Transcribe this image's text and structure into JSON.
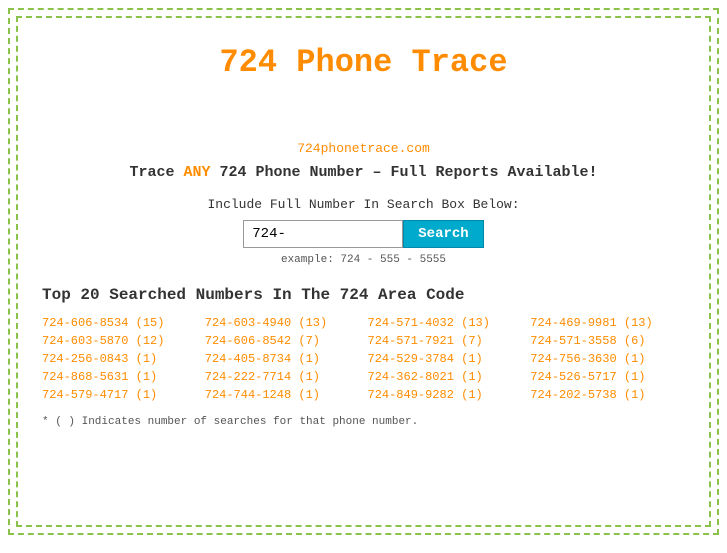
{
  "title": "724 Phone Trace",
  "siteUrl": "724phonetrace.com",
  "tagline": {
    "prefix": "Trace ",
    "highlight": "ANY",
    "suffix": " 724 Phone Number – Full Reports Available!"
  },
  "search": {
    "label": "Include Full Number In Search Box Below:",
    "inputValue": "724-",
    "placeholder": "724-",
    "buttonLabel": "Search",
    "example": "example: 724 - 555 - 5555"
  },
  "topSection": {
    "title": "Top 20 Searched Numbers In The 724 Area Code"
  },
  "phoneNumbers": [
    {
      "number": "724-606-8534",
      "count": "(15)"
    },
    {
      "number": "724-603-4940",
      "count": "(13)"
    },
    {
      "number": "724-571-4032",
      "count": "(13)"
    },
    {
      "number": "724-469-9981",
      "count": "(13)"
    },
    {
      "number": "724-603-5870",
      "count": "(12)"
    },
    {
      "number": "724-606-8542",
      "count": "(7)"
    },
    {
      "number": "724-571-7921",
      "count": "(7)"
    },
    {
      "number": "724-571-3558",
      "count": "(6)"
    },
    {
      "number": "724-256-0843",
      "count": "(1)"
    },
    {
      "number": "724-405-8734",
      "count": "(1)"
    },
    {
      "number": "724-529-3784",
      "count": "(1)"
    },
    {
      "number": "724-756-3630",
      "count": "(1)"
    },
    {
      "number": "724-868-5631",
      "count": "(1)"
    },
    {
      "number": "724-222-7714",
      "count": "(1)"
    },
    {
      "number": "724-362-8021",
      "count": "(1)"
    },
    {
      "number": "724-526-5717",
      "count": "(1)"
    },
    {
      "number": "724-579-4717",
      "count": "(1)"
    },
    {
      "number": "724-744-1248",
      "count": "(1)"
    },
    {
      "number": "724-849-9282",
      "count": "(1)"
    },
    {
      "number": "724-202-5738",
      "count": "(1)"
    }
  ],
  "footnote": "* ( ) Indicates number of searches for that phone number."
}
